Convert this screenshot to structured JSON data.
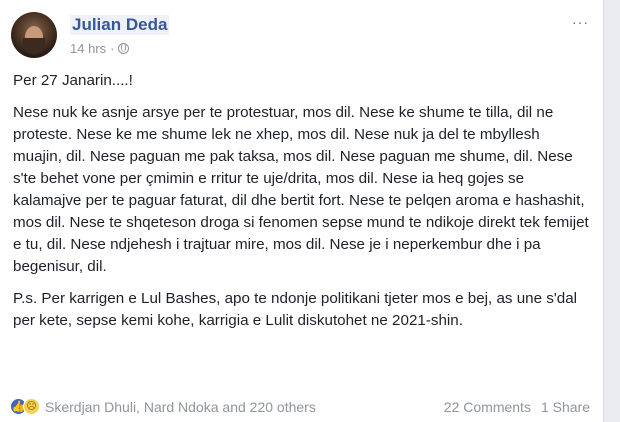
{
  "post": {
    "author": "Julian Deda",
    "time": "14 hrs",
    "separator": "·",
    "more": "···",
    "heading": "Per 27 Janarin....!",
    "body": "Nese nuk ke asnje arsye per te protestuar, mos dil. Nese ke shume te tilla, dil ne proteste. Nese ke me shume lek ne xhep, mos dil. Nese nuk ja del te mbyllesh muajin, dil. Nese paguan me pak taksa, mos dil. Nese paguan me shume, dil. Nese s'te behet vone per çmimin e rritur te uje/drita, mos dil. Nese ia heq gojes se kalamajve per te paguar faturat, dil dhe bertit fort. Nese te pelqen aroma e hashashit, mos dil. Nese te shqeteson droga si fenomen sepse mund te ndikoje direkt tek femijet e tu, dil. Nese ndjehesh i trajtuar mire, mos dil. Nese je i neperkembur dhe i pa begenisur, dil.",
    "ps": "P.s. Per karrigen e Lul Bashes, apo te ndonje politikani tjeter mos e bej, as une s'dal per kete, sepse kemi kohe, karrigia e Lulit diskutohet ne 2021-shin."
  },
  "footer": {
    "reactors": "Skerdjan Dhuli, Nard Ndoka and 220 others",
    "comments": "22 Comments",
    "shares": "1 Share"
  },
  "icons": {
    "like": "thumbs-up-icon",
    "sad": "sad-face-icon",
    "privacy": "globe-icon"
  },
  "colors": {
    "author": "#365899",
    "like": "#4267b2",
    "sad": "#f7cf51"
  }
}
